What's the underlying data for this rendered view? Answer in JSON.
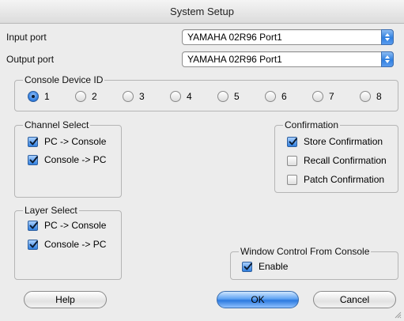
{
  "window": {
    "title": "System Setup"
  },
  "ports": {
    "input_label": "Input port",
    "input_value": "YAMAHA 02R96 Port1",
    "output_label": "Output port",
    "output_value": "YAMAHA 02R96 Port1"
  },
  "console_device_id": {
    "title": "Console Device ID",
    "options": [
      "1",
      "2",
      "3",
      "4",
      "5",
      "6",
      "7",
      "8"
    ],
    "selected": "1"
  },
  "channel_select": {
    "title": "Channel Select",
    "items": [
      {
        "label": "PC -> Console",
        "checked": true
      },
      {
        "label": "Console -> PC",
        "checked": true
      }
    ]
  },
  "confirmation": {
    "title": "Confirmation",
    "items": [
      {
        "label": "Store Confirmation",
        "checked": true
      },
      {
        "label": "Recall Confirmation",
        "checked": false
      },
      {
        "label": "Patch Confirmation",
        "checked": false
      }
    ]
  },
  "layer_select": {
    "title": "Layer Select",
    "items": [
      {
        "label": "PC -> Console",
        "checked": true
      },
      {
        "label": "Console -> PC",
        "checked": true
      }
    ]
  },
  "window_control": {
    "title": "Window Control From Console",
    "enable_label": "Enable",
    "enabled": true
  },
  "buttons": {
    "help": "Help",
    "ok": "OK",
    "cancel": "Cancel"
  },
  "colors": {
    "accent": "#2f7fe0",
    "background": "#ececec"
  }
}
